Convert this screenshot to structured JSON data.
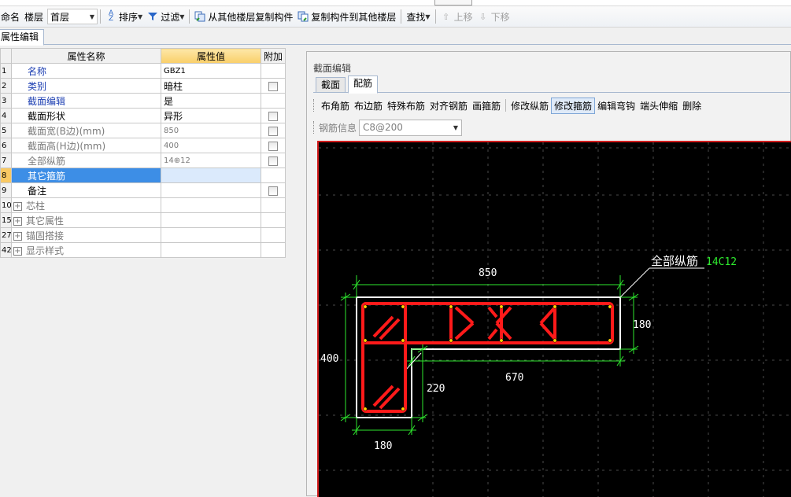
{
  "toolbar": {
    "rename_label": "命名",
    "floor_label": "楼层",
    "floor_value": "首层",
    "sort_label": "排序",
    "filter_label": "过滤",
    "copy_from_label": "从其他楼层复制构件",
    "copy_to_label": "复制构件到其他楼层",
    "find_label": "查找",
    "move_up_label": "上移",
    "move_down_label": "下移"
  },
  "property_tab": "属性编辑",
  "grid": {
    "headers": [
      "属性名称",
      "属性值",
      "附加"
    ],
    "rows": [
      {
        "num": "1",
        "name": "名称",
        "value": "GBZ1"
      },
      {
        "num": "2",
        "name": "类别",
        "value": "暗柱"
      },
      {
        "num": "3",
        "name": "截面编辑",
        "value": "是"
      },
      {
        "num": "4",
        "name": "截面形状",
        "value": "异形"
      },
      {
        "num": "5",
        "name": "截面宽(B边)(mm)",
        "value": "850"
      },
      {
        "num": "6",
        "name": "截面高(H边)(mm)",
        "value": "400"
      },
      {
        "num": "7",
        "name": "全部纵筋",
        "value": "14⊕12"
      },
      {
        "num": "8",
        "name": "其它箍筋",
        "value": ""
      },
      {
        "num": "9",
        "name": "备注",
        "value": ""
      },
      {
        "num": "10",
        "name": "芯柱",
        "value": ""
      },
      {
        "num": "15",
        "name": "其它属性",
        "value": ""
      },
      {
        "num": "27",
        "name": "锚固搭接",
        "value": ""
      },
      {
        "num": "42",
        "name": "显示样式",
        "value": ""
      }
    ]
  },
  "section_panel": {
    "title": "截面编辑",
    "tabs": [
      "截面",
      "配筋"
    ],
    "tools": [
      "布角筋",
      "布边筋",
      "特殊布筋",
      "对齐钢筋",
      "画箍筋",
      "修改纵筋",
      "修改箍筋",
      "编辑弯钩",
      "端头伸缩",
      "删除"
    ],
    "rebar_info_label": "钢筋信息",
    "rebar_info_value": "C8@200"
  },
  "canvas": {
    "all_bars_label": "全部纵筋",
    "all_bars_value": "14C12",
    "dim_top": "850",
    "dim_left": "400",
    "dim_right": "180",
    "dim_inner": "670",
    "dim_leg": "220",
    "dim_bottom": "180"
  },
  "colors": {
    "canvas_bg": "#000000",
    "rebar": "#ff1a1a",
    "dimension": "#2ee82e",
    "outline": "#ffffff",
    "selection": "#3d8ee6"
  }
}
